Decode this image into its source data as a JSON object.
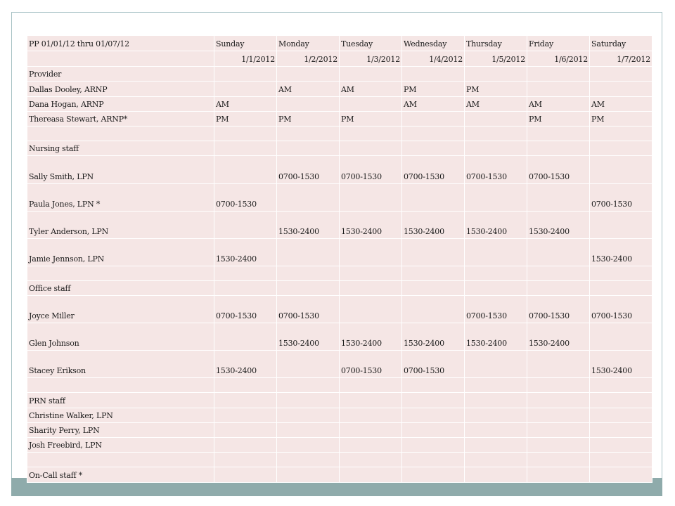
{
  "header": {
    "period": "PP 01/01/12 thru 01/07/12",
    "days": [
      "Sunday",
      "Monday",
      "Tuesday",
      "Wednesday",
      "Thursday",
      "Friday",
      "Saturday"
    ],
    "dates": [
      "1/1/2012",
      "1/2/2012",
      "1/3/2012",
      "1/4/2012",
      "1/5/2012",
      "1/6/2012",
      "1/7/2012"
    ]
  },
  "rows": [
    {
      "label": "Provider",
      "cells": [
        "",
        "",
        "",
        "",
        "",
        "",
        ""
      ]
    },
    {
      "label": "Dallas Dooley, ARNP",
      "cells": [
        "",
        "AM",
        "AM",
        "PM",
        "PM",
        "",
        ""
      ]
    },
    {
      "label": "Dana Hogan, ARNP",
      "cells": [
        "AM",
        "",
        "",
        "AM",
        "AM",
        "AM",
        "AM"
      ]
    },
    {
      "label": "Thereasa Stewart, ARNP*",
      "cells": [
        "PM",
        "PM",
        "PM",
        "",
        "",
        "PM",
        "PM"
      ]
    },
    {
      "label": "",
      "cells": [
        "",
        "",
        "",
        "",
        "",
        "",
        ""
      ]
    },
    {
      "label": "Nursing staff",
      "cells": [
        "",
        "",
        "",
        "",
        "",
        "",
        ""
      ]
    },
    {
      "label": "Sally Smith, LPN",
      "cells": [
        "",
        "0700-1530",
        "0700-1530",
        "0700-1530",
        "0700-1530",
        "0700-1530",
        ""
      ]
    },
    {
      "label": "Paula Jones, LPN *",
      "cells": [
        "0700-1530",
        "",
        "",
        "",
        "",
        "",
        "0700-1530"
      ]
    },
    {
      "label": "Tyler Anderson, LPN",
      "cells": [
        "",
        "1530-2400",
        "1530-2400",
        "1530-2400",
        "1530-2400",
        "1530-2400",
        ""
      ]
    },
    {
      "label": "Jamie Jennson, LPN",
      "cells": [
        "1530-2400",
        "",
        "",
        "",
        "",
        "",
        "1530-2400"
      ]
    },
    {
      "label": "",
      "cells": [
        "",
        "",
        "",
        "",
        "",
        "",
        ""
      ]
    },
    {
      "label": "Office staff",
      "cells": [
        "",
        "",
        "",
        "",
        "",
        "",
        ""
      ]
    },
    {
      "label": "Joyce Miller",
      "cells": [
        "0700-1530",
        "0700-1530",
        "",
        "",
        "0700-1530",
        "0700-1530",
        "0700-1530"
      ]
    },
    {
      "label": "Glen Johnson",
      "cells": [
        "",
        "1530-2400",
        "1530-2400",
        "1530-2400",
        "1530-2400",
        "1530-2400",
        ""
      ]
    },
    {
      "label": "Stacey Erikson",
      "cells": [
        "1530-2400",
        "",
        "0700-1530",
        "0700-1530",
        "",
        "",
        "1530-2400"
      ]
    },
    {
      "label": "",
      "cells": [
        "",
        "",
        "",
        "",
        "",
        "",
        ""
      ]
    },
    {
      "label": "PRN staff",
      "cells": [
        "",
        "",
        "",
        "",
        "",
        "",
        ""
      ]
    },
    {
      "label": "Christine Walker, LPN",
      "cells": [
        "",
        "",
        "",
        "",
        "",
        "",
        ""
      ]
    },
    {
      "label": "Sharity Perry, LPN",
      "cells": [
        "",
        "",
        "",
        "",
        "",
        "",
        ""
      ]
    },
    {
      "label": "Josh Freebird, LPN",
      "cells": [
        "",
        "",
        "",
        "",
        "",
        "",
        ""
      ]
    },
    {
      "label": "",
      "cells": [
        "",
        "",
        "",
        "",
        "",
        "",
        ""
      ]
    },
    {
      "label": "On-Call staff *",
      "cells": [
        "",
        "",
        "",
        "",
        "",
        "",
        ""
      ]
    }
  ],
  "colors": {
    "cell_background": "#f5e6e5",
    "frame_border": "#a7c2c5",
    "bottom_bar": "#8fabab"
  }
}
